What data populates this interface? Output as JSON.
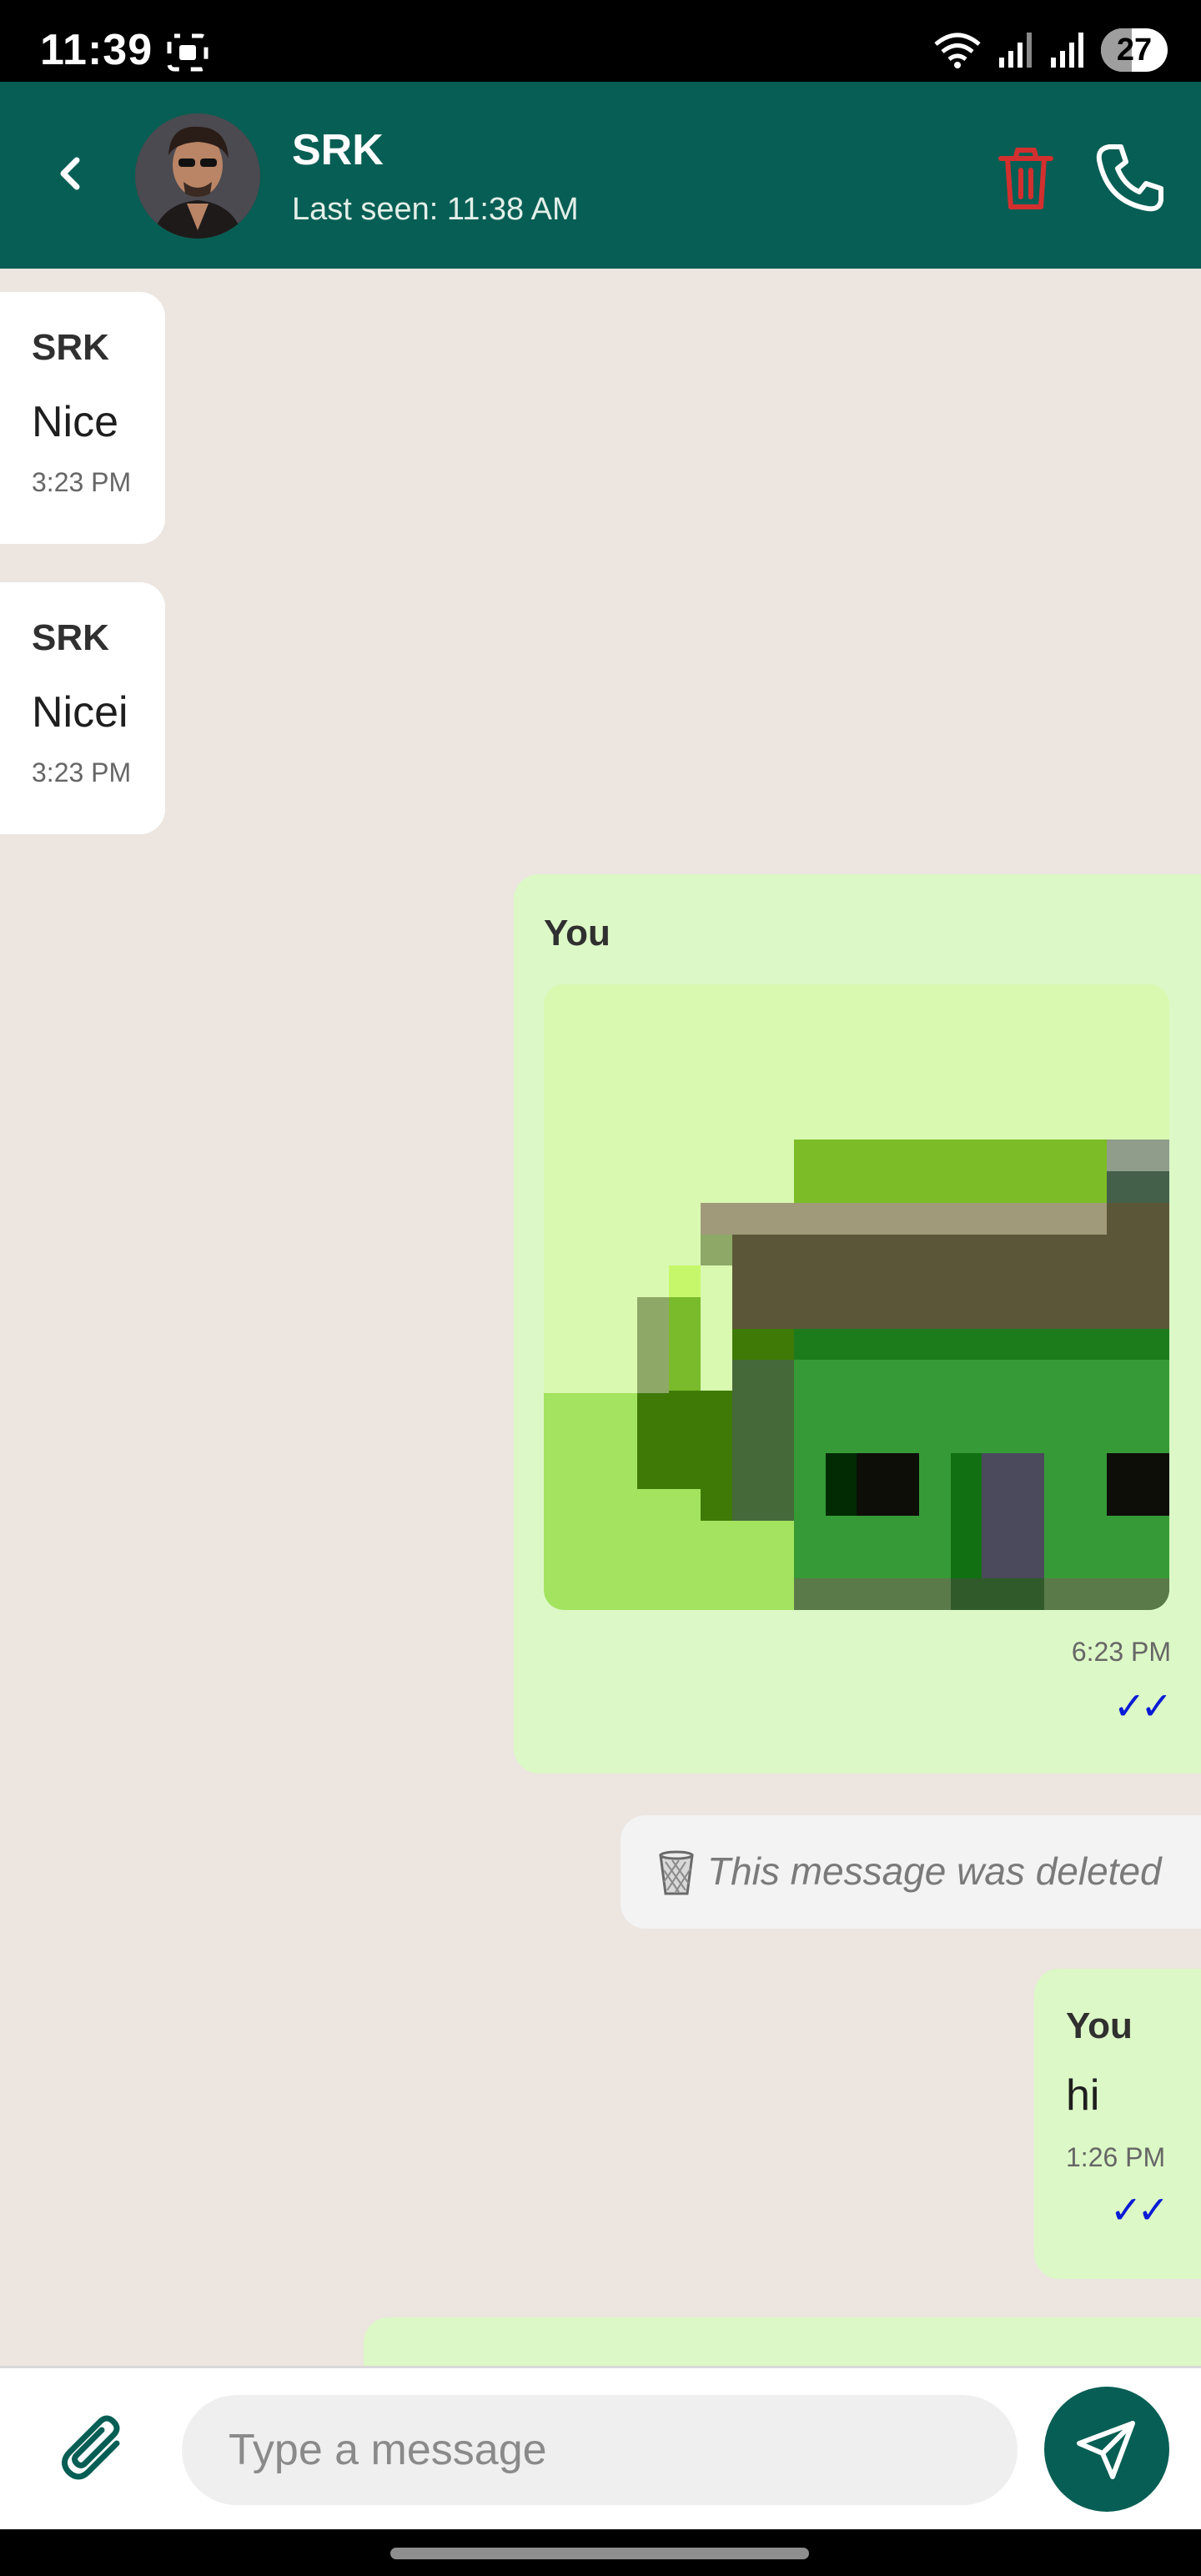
{
  "status_bar": {
    "time": "11:39",
    "battery": "27"
  },
  "header": {
    "contact_name": "SRK",
    "last_seen": "Last seen: 11:38 AM"
  },
  "messages": [
    {
      "sender": "SRK",
      "text": "Nice",
      "time": "3:23 PM",
      "direction": "incoming"
    },
    {
      "sender": "SRK",
      "text": "Nicei",
      "time": "3:23 PM",
      "direction": "incoming"
    },
    {
      "sender": "You",
      "type": "image",
      "time": "6:23 PM",
      "ticks": "✓✓",
      "direction": "outgoing"
    },
    {
      "type": "deleted",
      "text": "This message was deleted",
      "direction": "outgoing"
    },
    {
      "sender": "You",
      "text": "hi",
      "time": "1:26 PM",
      "ticks": "✓✓",
      "direction": "outgoing"
    }
  ],
  "input": {
    "placeholder": "Type a message"
  },
  "colors": {
    "header": "#075e54",
    "outgoing_bubble": "#dcf8c6",
    "incoming_bubble": "#ffffff",
    "chat_background": "#ece5e0",
    "read_ticks": "#0a1bd6",
    "delete_icon": "#d32f2f"
  },
  "icons": {
    "back": "chevron-left-icon",
    "delete": "trash-icon",
    "call": "phone-icon",
    "attach": "paperclip-icon",
    "send": "send-icon"
  }
}
